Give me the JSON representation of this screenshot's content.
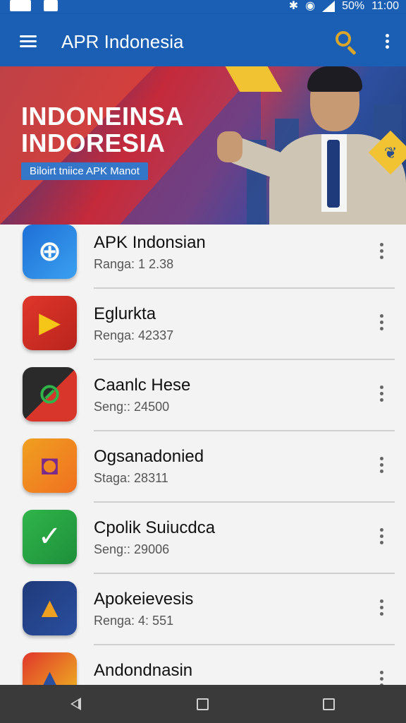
{
  "status_bar": {
    "battery": "50%",
    "time": "11:00",
    "icons": [
      "image-icon",
      "download-icon",
      "bluetooth-icon",
      "wifi-icon",
      "signal-icon"
    ]
  },
  "app_bar": {
    "title": "APR Indonesia",
    "icons": [
      "menu-icon",
      "search-icon",
      "more-vert-icon"
    ]
  },
  "banner": {
    "headline_line1": "INDONEINSA",
    "headline_line2": "INDORESIA",
    "cta": "Biloirt tniice APK Manot"
  },
  "apps": [
    {
      "name": "APK Indonsian",
      "meta": "Ranga: 1 2.38",
      "icon": "puzzle-icon",
      "color_from": "#1e6fd6",
      "color_to": "#3aa0f0"
    },
    {
      "name": "Eglurkta",
      "meta": "Renga: 42337",
      "icon": "play-icon",
      "color_from": "#e0362b",
      "color_to": "#b8241c"
    },
    {
      "name": "Caanlc Hese",
      "meta": "Seng:: 24500",
      "icon": "connector-icon",
      "color_from": "#2a2a2a",
      "color_to": "#d9362b"
    },
    {
      "name": "Ogsanadonied",
      "meta": "Staga: 28311",
      "icon": "camera-icon",
      "color_from": "#f0a020",
      "color_to": "#f07020"
    },
    {
      "name": "Cpolik Suiucdca",
      "meta": "Seng:: 29006",
      "icon": "checkmark-icon",
      "color_from": "#2fb54a",
      "color_to": "#1e8f3a"
    },
    {
      "name": "Apokeievesis",
      "meta": "Renga: 4: 551",
      "icon": "triangle-icon",
      "color_from": "#1f3a7a",
      "color_to": "#c23a2a"
    },
    {
      "name": "Andondnasin",
      "meta": "",
      "icon": "triangle-icon",
      "color_from": "#e0362b",
      "color_to": "#f0c020"
    }
  ],
  "nav_bar": {
    "icons": [
      "back-icon",
      "home-icon",
      "recents-icon"
    ]
  }
}
